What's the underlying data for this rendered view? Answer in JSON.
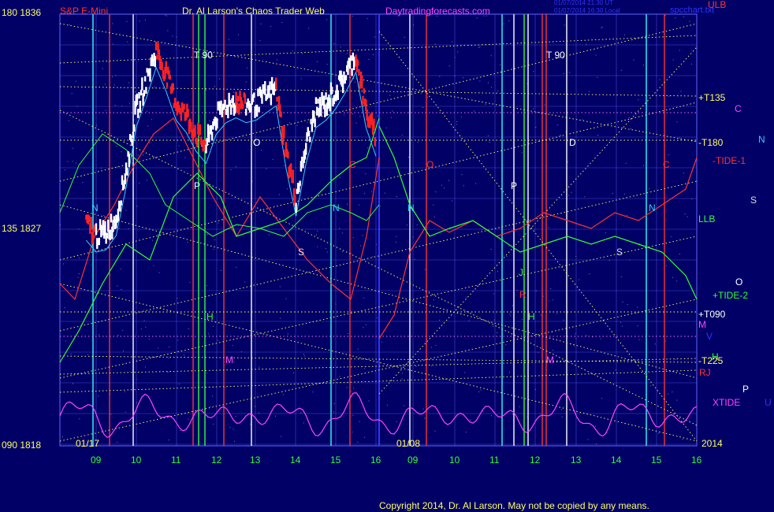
{
  "header": {
    "instrument": "S&P E-Mini",
    "title": "Dr. Al Larson's Chaos Trader Web",
    "site": "Daytradingforecasts.com",
    "stamp1": "01/07/2014 21:30 UT",
    "stamp2": "01/07/2014 16:30 Local",
    "corner": "spcchart.txt"
  },
  "y_axis": {
    "top": "180  1836",
    "mid": "135  1827",
    "bottom": "090  1818"
  },
  "footer": {
    "copyright": "Copyright 2014, Dr. Al Larson. May not be copied by any means."
  },
  "x_axis": {
    "left_date": "01/17",
    "right_date": "01/08",
    "year": "2014",
    "left_hours": [
      "09",
      "10",
      "11",
      "12",
      "13",
      "14",
      "15",
      "16"
    ],
    "right_hours": [
      "09",
      "10",
      "11",
      "12",
      "13",
      "14",
      "15",
      "16"
    ]
  },
  "right_labels": [
    {
      "text": "ULB",
      "color": "#ff3333"
    },
    {
      "text": "+T135",
      "color": "#ffff66"
    },
    {
      "text": "C",
      "color": "#ff44ff"
    },
    {
      "text": "N",
      "color": "#33ccff"
    },
    {
      "text": "-T180",
      "color": "#ffff66"
    },
    {
      "text": "-TIDE-1",
      "color": "#ff3333"
    },
    {
      "text": "S",
      "color": "#dddddd"
    },
    {
      "text": "LLB",
      "color": "#33ff33"
    },
    {
      "text": "O",
      "color": "#ffffff"
    },
    {
      "text": "+TIDE-2",
      "color": "#33ff33"
    },
    {
      "text": "+T090",
      "color": "#ffffff"
    },
    {
      "text": "M",
      "color": "#ff44ff"
    },
    {
      "text": "V",
      "color": "#3333ff"
    },
    {
      "text": "H",
      "color": "#33ff33"
    },
    {
      "text": "-T225",
      "color": "#ffff66"
    },
    {
      "text": "RJ",
      "color": "#ff3333"
    },
    {
      "text": "P",
      "color": "#ffffff"
    },
    {
      "text": "XTIDE",
      "color": "#ff44ff"
    },
    {
      "text": "U",
      "color": "#3333ff"
    }
  ],
  "chart_labels": {
    "t90_left": "T   90",
    "t90_right": "T   90",
    "letters": [
      "N",
      "O",
      "P",
      "S",
      "H",
      "M",
      "N",
      "C",
      "D",
      "N",
      "C",
      "P",
      "N",
      "S",
      "O",
      "J",
      "R",
      "H",
      "M"
    ]
  },
  "colors": {
    "background": "#000066",
    "grid": "#6666ff",
    "tide1": "#ff3333",
    "tide2": "#33ff33",
    "xtide": "#ff44ff",
    "price_up": "#ffffff",
    "price_down": "#ff2222",
    "avg": "#33ccff",
    "vline_cyan": "#33ffff",
    "vline_red": "#ff3333",
    "vline_white": "#ffffff",
    "vline_green": "#33ff33",
    "trend": "#ffff66"
  },
  "chart_data": {
    "type": "line",
    "title": "S&P E-Mini",
    "y_label_left": "",
    "ylim": [
      1818,
      1836
    ],
    "ytick_labels": [
      "1836",
      "1827",
      "1818"
    ],
    "ytick_angles": [
      "180",
      "135",
      "090"
    ],
    "x_hours": [
      "09",
      "10",
      "11",
      "12",
      "13",
      "14",
      "15",
      "16"
    ],
    "sessions": [
      "01/17",
      "01/08"
    ],
    "series": [
      {
        "name": "S&P E-Mini",
        "x": [
          8.75,
          9.0,
          9.25,
          9.5,
          9.75,
          10.0,
          10.25,
          10.5,
          10.75,
          11.0,
          11.25,
          11.5,
          11.75,
          12.0,
          12.25,
          12.5,
          12.75,
          13.0,
          13.25,
          13.5,
          13.75,
          14.0,
          14.25,
          14.5,
          14.75,
          15.0,
          15.25,
          15.5,
          15.75,
          16.0
        ],
        "values": [
          1827.3,
          1826.8,
          1826.9,
          1827.5,
          1829.5,
          1832.0,
          1833.2,
          1834.5,
          1833.5,
          1832.3,
          1831.8,
          1831.0,
          1830.5,
          1831.7,
          1832.2,
          1832.4,
          1832.2,
          1832.3,
          1832.6,
          1832.9,
          1830.3,
          1828.3,
          1830.5,
          1832.0,
          1832.3,
          1832.8,
          1833.5,
          1834.3,
          1832.0,
          1830.8
        ]
      }
    ]
  }
}
